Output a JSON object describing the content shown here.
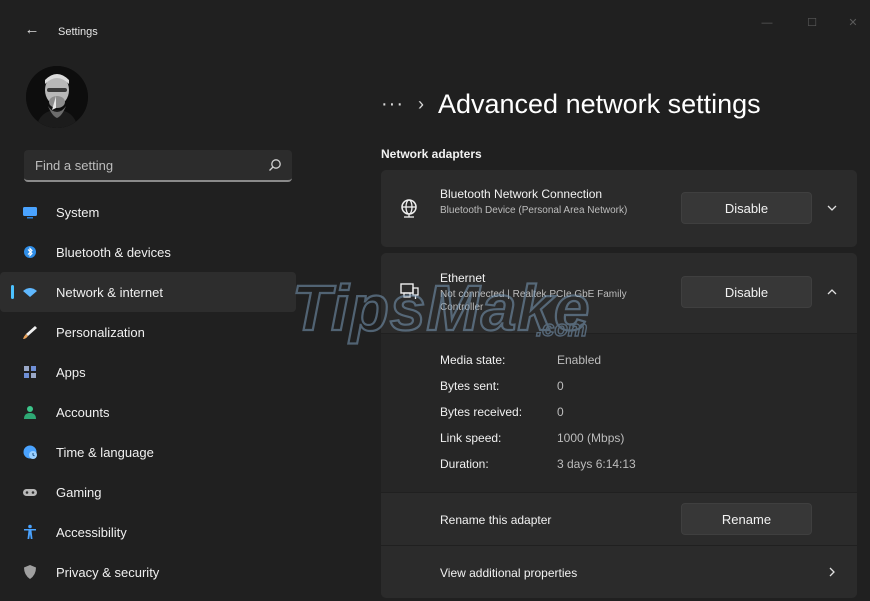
{
  "window": {
    "title": "Settings",
    "back_glyph": "←",
    "min_glyph": "—",
    "max_glyph": "☐",
    "close_glyph": "✕"
  },
  "search": {
    "placeholder": "Find a setting",
    "icon": "search-icon"
  },
  "sidebar": {
    "items": [
      {
        "label": "System",
        "icon": "monitor-icon",
        "color": "#4aa3ff"
      },
      {
        "label": "Bluetooth & devices",
        "icon": "bluetooth-icon",
        "color": "#4aa3ff"
      },
      {
        "label": "Network & internet",
        "icon": "wifi-icon",
        "color": "#7bc7ff",
        "selected": true
      },
      {
        "label": "Personalization",
        "icon": "brush-icon",
        "color": "#e8a25c"
      },
      {
        "label": "Apps",
        "icon": "apps-icon",
        "color": "#9aa8c8"
      },
      {
        "label": "Accounts",
        "icon": "person-icon",
        "color": "#3cc58a"
      },
      {
        "label": "Time & language",
        "icon": "globe-clock-icon",
        "color": "#4aa3ff"
      },
      {
        "label": "Gaming",
        "icon": "gamepad-icon",
        "color": "#b9b9b9"
      },
      {
        "label": "Accessibility",
        "icon": "accessibility-icon",
        "color": "#4aa3ff"
      },
      {
        "label": "Privacy & security",
        "icon": "shield-icon",
        "color": "#9a9a9a"
      }
    ]
  },
  "breadcrumb": {
    "more": "···",
    "separator": "›",
    "title": "Advanced network settings"
  },
  "section_label": "Network adapters",
  "adapters": [
    {
      "name": "Bluetooth Network Connection",
      "description": "Bluetooth Device (Personal Area Network)",
      "button": "Disable",
      "expanded": false
    },
    {
      "name": "Ethernet",
      "description": "Not connected | Realtek PCIe GbE Family Controller",
      "button": "Disable",
      "expanded": true
    }
  ],
  "details": [
    {
      "key": "Media state:",
      "value": "Enabled"
    },
    {
      "key": "Bytes sent:",
      "value": "0"
    },
    {
      "key": "Bytes received:",
      "value": "0"
    },
    {
      "key": "Link speed:",
      "value": "1000 (Mbps)"
    },
    {
      "key": "Duration:",
      "value": "3 days 6:14:13"
    }
  ],
  "rename": {
    "label": "Rename this adapter",
    "button": "Rename"
  },
  "properties": {
    "label": "View additional properties"
  },
  "watermark": {
    "text": "TipsMake",
    "suffix": ".com"
  },
  "colors": {
    "accent": "#4cc2ff",
    "background": "#202020",
    "card": "#2b2b2b"
  }
}
